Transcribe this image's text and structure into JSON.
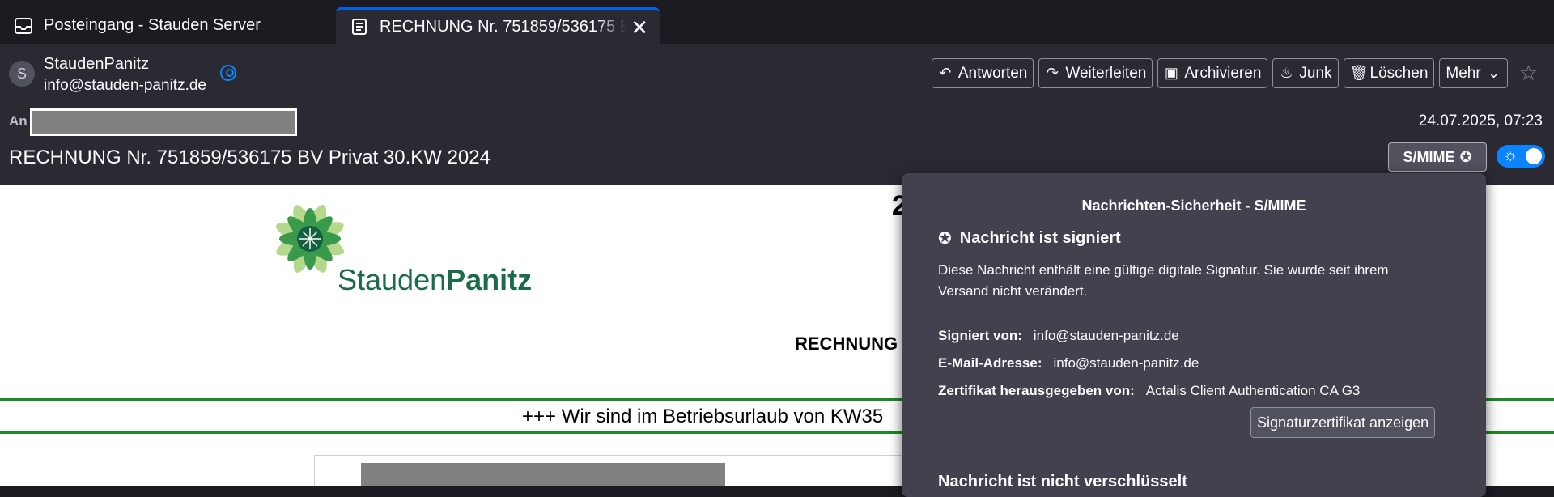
{
  "tabs": [
    {
      "label": "Posteingang - Stauden Server",
      "icon": "inbox-icon"
    },
    {
      "label": "RECHNUNG Nr. 751859/536175 BV Privat 30.KW 2024",
      "icon": "message-icon",
      "close": "✕"
    }
  ],
  "message": {
    "avatar_initial": "S",
    "from_name": "StaudenPanitz",
    "from_email": "info@stauden-panitz.de",
    "to_label": "An",
    "date": "24.07.2025, 07:23",
    "subject": "RECHNUNG Nr. 751859/536175 BV Privat 30.KW 2024"
  },
  "toolbar": {
    "reply": "Antworten",
    "forward": "Weiterleiten",
    "archive": "Archivieren",
    "junk": "Junk",
    "delete": "Löschen",
    "more": "Mehr"
  },
  "security": {
    "smime_label": "S/MIME",
    "toggle_on": true
  },
  "body": {
    "brand_regular": "Stauden",
    "brand_bold": "Panitz",
    "header_fragment": "2",
    "rechnung_fragment": "RECHNUNG",
    "banner_fragment": "+++ Wir sind im Betriebsurlaub von KW35",
    "accent_color": "#1e8a24"
  },
  "popup": {
    "title": "Nachrichten-Sicherheit - S/MIME",
    "signed_heading": "Nachricht ist signiert",
    "signed_desc": "Diese Nachricht enthält eine gültige digitale Signatur. Sie wurde seit ihrem Versand nicht verändert.",
    "signed_by_label": "Signiert von:",
    "signed_by_value": "info@stauden-panitz.de",
    "email_label": "E-Mail-Adresse:",
    "email_value": "info@stauden-panitz.de",
    "issuer_label": "Zertifikat herausgegeben von:",
    "issuer_value": "Actalis Client Authentication CA G3",
    "view_cert_button": "Signaturzertifikat anzeigen",
    "encryption_heading": "Nachricht ist nicht verschlüsselt"
  }
}
